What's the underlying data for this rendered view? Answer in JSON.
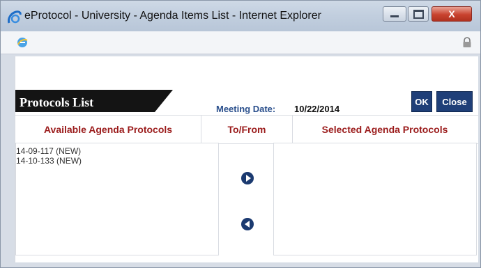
{
  "window": {
    "title": "eProtocol - University - Agenda Items List - Internet Explorer",
    "controls": {
      "minimize_icon": "minimize-icon",
      "maximize_icon": "maximize-icon",
      "close_icon": "close-icon",
      "close_glyph": "X"
    }
  },
  "address_bar": {
    "icons": [
      "ie-icon",
      "lock-icon"
    ]
  },
  "page": {
    "section_title": "Protocols List",
    "meeting_date_label": "Meeting Date:",
    "meeting_date_value": "10/22/2014",
    "ok_label": "OK",
    "close_label": "Close",
    "columns": {
      "available": "Available Agenda Protocols",
      "tofrom": "To/From",
      "selected": "Selected Agenda Protocols"
    },
    "available_items": [
      "14-09-117 (NEW)",
      "14-10-133 (NEW)"
    ],
    "selected_items": [],
    "colors": {
      "header_text": "#9b1c1c",
      "button_bg": "#1f3f78",
      "tab_bg": "#141414",
      "meeting_label": "#2a4f8c"
    }
  }
}
